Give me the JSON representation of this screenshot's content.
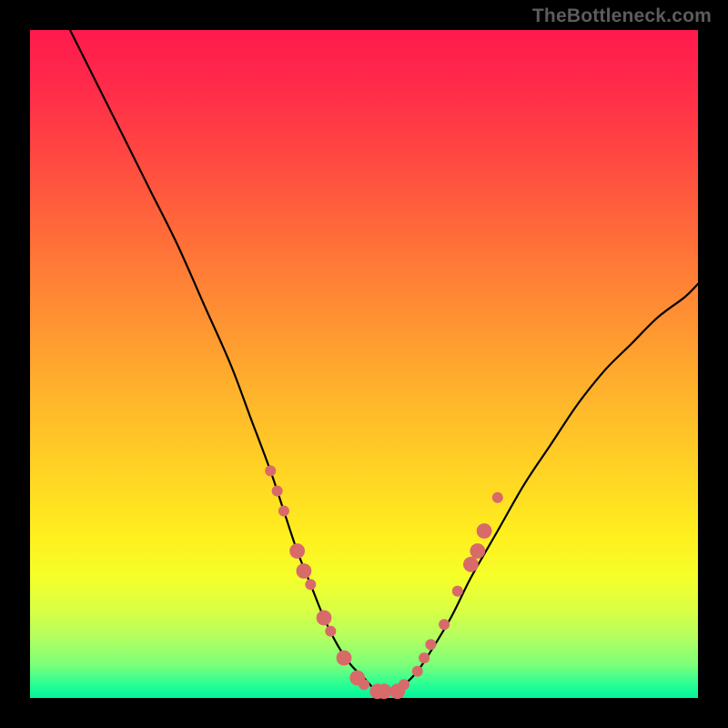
{
  "watermark": "TheBottleneck.com",
  "colors": {
    "frame": "#000000",
    "watermark": "#5c5c5c",
    "curve": "#000000",
    "marker": "#d86a6a",
    "gradient_stops": [
      "#ff1a4d",
      "#ff2a4a",
      "#ff4542",
      "#ff6a3a",
      "#ff8e33",
      "#ffb22c",
      "#ffd324",
      "#fff01f",
      "#f4ff2a",
      "#d8ff45",
      "#b2ff60",
      "#7dff7a",
      "#28ff94",
      "#00f59a"
    ]
  },
  "chart_data": {
    "type": "line",
    "title": "",
    "xlabel": "",
    "ylabel": "",
    "xlim": [
      0,
      100
    ],
    "ylim": [
      0,
      100
    ],
    "series": [
      {
        "name": "bottleneck-curve",
        "x": [
          6,
          10,
          14,
          18,
          22,
          26,
          30,
          33,
          36,
          38,
          40,
          42,
          44,
          46,
          48,
          50,
          52,
          54,
          56,
          58,
          60,
          63,
          66,
          70,
          74,
          78,
          82,
          86,
          90,
          94,
          98,
          100
        ],
        "y": [
          100,
          92,
          84,
          76,
          68,
          59,
          50,
          42,
          34,
          28,
          22,
          17,
          12,
          8,
          5,
          3,
          1,
          1,
          2,
          4,
          7,
          12,
          18,
          25,
          32,
          38,
          44,
          49,
          53,
          57,
          60,
          62
        ]
      }
    ],
    "markers": {
      "name": "highlighted-points",
      "points": [
        {
          "x": 36,
          "y": 34,
          "r": 1.0
        },
        {
          "x": 37,
          "y": 31,
          "r": 1.0
        },
        {
          "x": 38,
          "y": 28,
          "r": 1.0
        },
        {
          "x": 40,
          "y": 22,
          "r": 1.4
        },
        {
          "x": 41,
          "y": 19,
          "r": 1.4
        },
        {
          "x": 42,
          "y": 17,
          "r": 1.0
        },
        {
          "x": 44,
          "y": 12,
          "r": 1.4
        },
        {
          "x": 45,
          "y": 10,
          "r": 1.0
        },
        {
          "x": 47,
          "y": 6,
          "r": 1.4
        },
        {
          "x": 49,
          "y": 3,
          "r": 1.4
        },
        {
          "x": 50,
          "y": 2,
          "r": 1.0
        },
        {
          "x": 52,
          "y": 1,
          "r": 1.4
        },
        {
          "x": 53,
          "y": 1,
          "r": 1.4
        },
        {
          "x": 55,
          "y": 1,
          "r": 1.4
        },
        {
          "x": 56,
          "y": 2,
          "r": 1.0
        },
        {
          "x": 58,
          "y": 4,
          "r": 1.0
        },
        {
          "x": 59,
          "y": 6,
          "r": 1.0
        },
        {
          "x": 60,
          "y": 8,
          "r": 1.0
        },
        {
          "x": 62,
          "y": 11,
          "r": 1.0
        },
        {
          "x": 64,
          "y": 16,
          "r": 1.0
        },
        {
          "x": 66,
          "y": 20,
          "r": 1.4
        },
        {
          "x": 67,
          "y": 22,
          "r": 1.4
        },
        {
          "x": 68,
          "y": 25,
          "r": 1.4
        },
        {
          "x": 70,
          "y": 30,
          "r": 1.0
        }
      ]
    }
  }
}
